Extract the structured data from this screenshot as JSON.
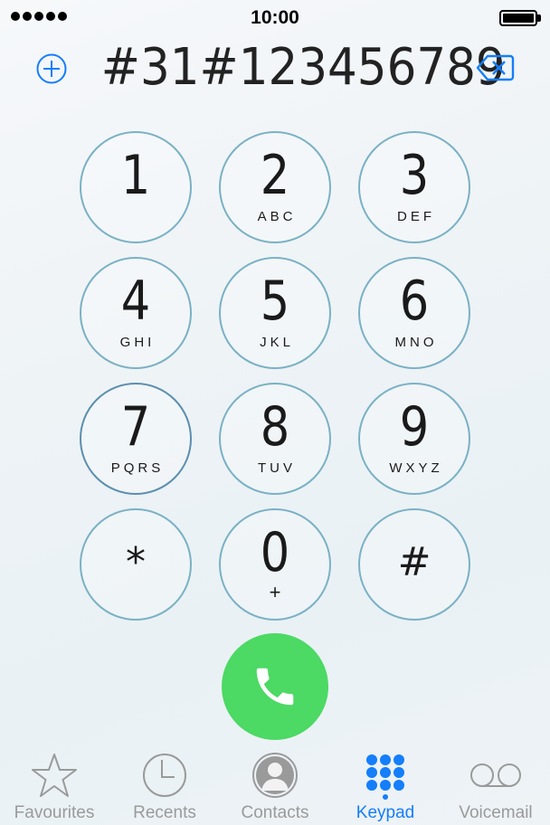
{
  "status_bar": {
    "time": "10:00",
    "signal_icon": "signal-dots-icon",
    "battery_icon": "battery-full-icon"
  },
  "dialer": {
    "number": "#31#123456789",
    "add_contact_icon": "plus-circle-icon",
    "delete_icon": "backspace-icon",
    "accent_color": "#147efb"
  },
  "keypad": {
    "keys": [
      {
        "digit": "1",
        "letters": ""
      },
      {
        "digit": "2",
        "letters": "ABC"
      },
      {
        "digit": "3",
        "letters": "DEF"
      },
      {
        "digit": "4",
        "letters": "GHI"
      },
      {
        "digit": "5",
        "letters": "JKL"
      },
      {
        "digit": "6",
        "letters": "MNO"
      },
      {
        "digit": "7",
        "letters": "PQRS"
      },
      {
        "digit": "8",
        "letters": "TUV"
      },
      {
        "digit": "9",
        "letters": "WXYZ"
      },
      {
        "digit": "*",
        "letters": ""
      },
      {
        "digit": "0",
        "letters": "+"
      },
      {
        "digit": "#",
        "letters": ""
      }
    ],
    "call_icon": "phone-icon",
    "call_color": "#4cd964"
  },
  "tabs": [
    {
      "label": "Favourites",
      "icon": "star-icon",
      "active": false
    },
    {
      "label": "Recents",
      "icon": "clock-icon",
      "active": false
    },
    {
      "label": "Contacts",
      "icon": "person-icon",
      "active": false
    },
    {
      "label": "Keypad",
      "icon": "keypad-grid-icon",
      "active": true
    },
    {
      "label": "Voicemail",
      "icon": "voicemail-icon",
      "active": false
    }
  ],
  "colors": {
    "active_tab": "#147efb",
    "inactive_tab": "#9a9a9a",
    "key_border": "#7ab1c4"
  }
}
